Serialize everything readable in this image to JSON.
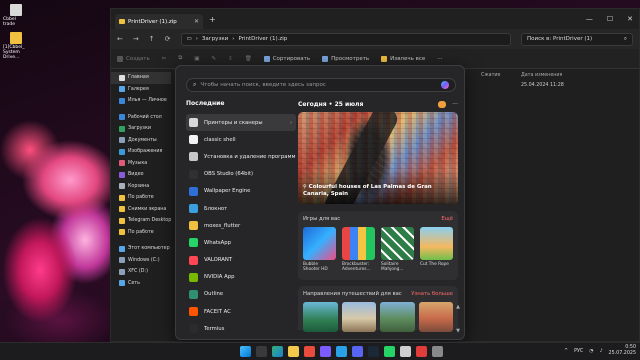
{
  "desktop": {
    "icons": [
      {
        "label": "Cbbel trade",
        "color": "#d8d8d8"
      },
      {
        "label": "[1]Cbbel_ System Drive...",
        "color": "#f0c040"
      }
    ]
  },
  "explorer": {
    "tab_title": "PrintDriver (1).zip",
    "breadcrumb": [
      "Загрузки",
      "PrintDriver (1).zip"
    ],
    "search_placeholder": "Поиск в: PrintDriver (1)",
    "toolbar": {
      "create": "Создать",
      "sort": "Сортировать",
      "view": "Просмотреть",
      "extract": "Извлечь все",
      "more": "···"
    },
    "sidebar": [
      {
        "label": "Главная",
        "icon": "home-icon",
        "color": "#e0e0e0",
        "selected": true
      },
      {
        "label": "Галерея",
        "icon": "gallery-icon",
        "color": "#58a6e8"
      },
      {
        "label": "Илья — Личное",
        "icon": "cloud-icon",
        "color": "#3a86d8"
      },
      {
        "label": "Рабочий стол",
        "icon": "desktop-icon",
        "color": "#3a86d8"
      },
      {
        "label": "Загрузки",
        "icon": "download-icon",
        "color": "#32a060"
      },
      {
        "label": "Документы",
        "icon": "documents-icon",
        "color": "#8aa0b8"
      },
      {
        "label": "Изображения",
        "icon": "pictures-icon",
        "color": "#3a9bd8"
      },
      {
        "label": "Музыка",
        "icon": "music-icon",
        "color": "#e05a7a"
      },
      {
        "label": "Видео",
        "icon": "video-icon",
        "color": "#8a5ad8"
      },
      {
        "label": "Корзина",
        "icon": "recycle-bin-icon",
        "color": "#a8b0b8"
      },
      {
        "label": "По работе",
        "icon": "folder-icon",
        "color": "#f0c040"
      },
      {
        "label": "Снимки экрана",
        "icon": "folder-icon",
        "color": "#f0c040"
      },
      {
        "label": "Telegram Desktop",
        "icon": "folder-icon",
        "color": "#f0c040"
      },
      {
        "label": "По работе",
        "icon": "folder-icon",
        "color": "#f0c040"
      },
      {
        "label": "Этот компьютер",
        "icon": "pc-icon",
        "color": "#58a6e8"
      },
      {
        "label": "Windows (C:)",
        "icon": "drive-icon",
        "color": "#8aa0b8"
      },
      {
        "label": "XFC (D:)",
        "icon": "drive-icon",
        "color": "#8aa0b8"
      },
      {
        "label": "Сеть",
        "icon": "network-icon",
        "color": "#58a6e8"
      }
    ],
    "columns": [
      "Сжатие",
      "Дата изменения"
    ],
    "rows": [
      {
        "date": "25.04.2024 11:28"
      }
    ]
  },
  "start_menu": {
    "search_placeholder": "Чтобы начать поиск, введите здесь запрос",
    "recent_title": "Последние",
    "apps": [
      {
        "label": "Принтеры и сканеры",
        "color": "#d8d8d8",
        "highlighted": true
      },
      {
        "label": "classic shell",
        "color": "#f2f2f2"
      },
      {
        "label": "Установка и удаление программ",
        "color": "#c8c8c8"
      },
      {
        "label": "OBS Studio (64bit)",
        "color": "#303030"
      },
      {
        "label": "Wallpaper Engine",
        "color": "#2e6fd8"
      },
      {
        "label": "Блокнот",
        "color": "#3aa0e0"
      },
      {
        "label": "moxes_flutter",
        "color": "#f0c040"
      },
      {
        "label": "WhatsApp",
        "color": "#25d366"
      },
      {
        "label": "VALORANT",
        "color": "#ff4655"
      },
      {
        "label": "NVIDIA App",
        "color": "#76b900"
      },
      {
        "label": "Outline",
        "color": "#2f8f6f"
      },
      {
        "label": "FACEIT AC",
        "color": "#ff5500"
      },
      {
        "label": "Termius",
        "color": "#2b2b2b"
      }
    ],
    "feed": {
      "date": "Сегодня  •  25 июля",
      "hero_caption": "Colourful houses of Las Palmas de Gran Canaria, Spain",
      "games_title": "Игры для вас",
      "games_more": "Ещё",
      "games": [
        {
          "name": "Bubble Shooter HD"
        },
        {
          "name": "Brockbuster: Adventures..."
        },
        {
          "name": "Solitaire Mahjong..."
        },
        {
          "name": "Cut The Rope"
        }
      ],
      "travel_title": "Направления путешествий для вас",
      "travel_more": "Узнать больше"
    }
  },
  "taskbar": {
    "lang": "РУС",
    "time": "0:50",
    "date": "25.07.2025"
  }
}
